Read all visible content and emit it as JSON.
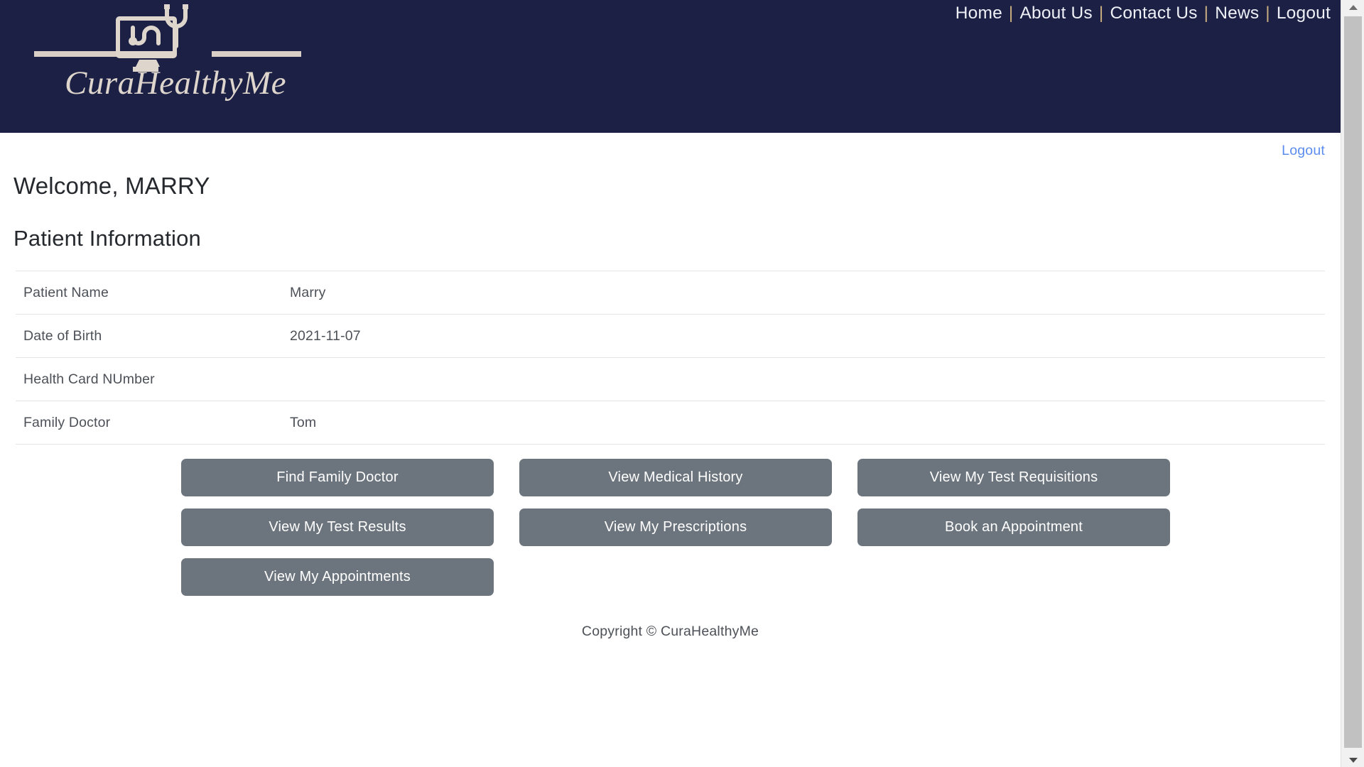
{
  "header": {
    "logo": {
      "wordmark": "CuraHealthyMe",
      "icon_name": "monitor-stethoscope-icon",
      "brand_cream": "#ded5cd",
      "brand_navy": "#1b2044"
    },
    "nav": {
      "separator": "|",
      "items": [
        {
          "label": "Home"
        },
        {
          "label": "About Us"
        },
        {
          "label": "Contact Us"
        },
        {
          "label": "News"
        },
        {
          "label": "Logout"
        }
      ]
    }
  },
  "main": {
    "logout_link": "Logout",
    "welcome_title": "Welcome, MARRY",
    "section_title": "Patient Information",
    "patient_info": {
      "rows": [
        {
          "label": "Patient Name",
          "value": "Marry"
        },
        {
          "label": "Date of Birth",
          "value": "2021-11-07"
        },
        {
          "label": "Health Card NUmber",
          "value": ""
        },
        {
          "label": "Family Doctor",
          "value": "Tom"
        }
      ]
    },
    "actions": {
      "accent_color": "#6c757d",
      "buttons": [
        {
          "label": "Find Family Doctor",
          "name": "find-family-doctor-button"
        },
        {
          "label": "View Medical History",
          "name": "view-medical-history-button"
        },
        {
          "label": "View My Test Requisitions",
          "name": "view-my-test-requisitions-button"
        },
        {
          "label": "View My Test Results",
          "name": "view-my-test-results-button"
        },
        {
          "label": "View My Prescriptions",
          "name": "view-my-prescriptions-button"
        },
        {
          "label": "Book an Appointment",
          "name": "book-an-appointment-button"
        },
        {
          "label": "View My Appointments",
          "name": "view-my-appointments-button"
        }
      ]
    }
  },
  "footer": {
    "copyright": "Copyright © CuraHealthyMe"
  },
  "scrollbar": {
    "up_arrow_icon": "triangle-up-icon",
    "down_arrow_icon": "triangle-down-icon",
    "thumb_color": "#c1c1c1",
    "track_color": "#f1f1f1"
  }
}
